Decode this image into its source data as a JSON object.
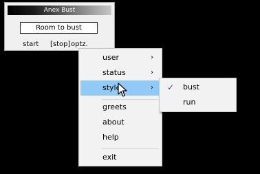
{
  "window": {
    "title": "Anex Bust",
    "textbox_value": "Room to bust",
    "buttons": {
      "start": "start",
      "stop": "[stop]",
      "optz": "optz."
    }
  },
  "context_menu": {
    "items": [
      {
        "label": "user",
        "has_submenu": true
      },
      {
        "label": "status",
        "has_submenu": true
      },
      {
        "label": "style",
        "has_submenu": true,
        "highlighted": true
      },
      {
        "label": "greets"
      },
      {
        "label": "about"
      },
      {
        "label": "help"
      },
      {
        "label": "exit"
      }
    ],
    "arrow_glyph": "›"
  },
  "submenu_style": {
    "items": [
      {
        "label": "bust",
        "checked": true
      },
      {
        "label": "run"
      }
    ],
    "check_glyph": "✓"
  },
  "colors": {
    "background": "#000000",
    "menu_bg": "#f2f2f2",
    "highlight": "#91c9f7",
    "check": "#2b4f8f"
  },
  "icons": {
    "cursor": "arrow-pointer-icon",
    "arrow": "chevron-right-icon",
    "check": "checkmark-icon"
  }
}
